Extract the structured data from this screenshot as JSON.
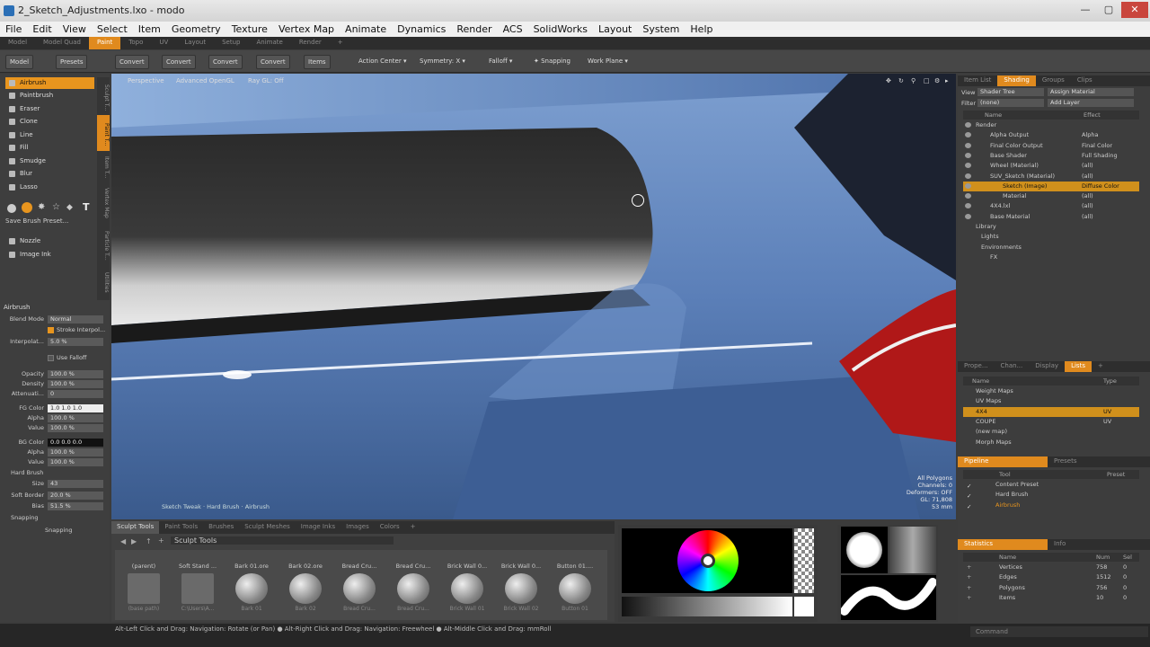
{
  "window": {
    "title": "2_Sketch_Adjustments.lxo - modo"
  },
  "menu": [
    "File",
    "Edit",
    "View",
    "Select",
    "Item",
    "Geometry",
    "Texture",
    "Vertex Map",
    "Animate",
    "Dynamics",
    "Render",
    "ACS",
    "SolidWorks",
    "Layout",
    "System",
    "Help"
  ],
  "layout_tabs": [
    "Model",
    "Model Quad",
    "Paint",
    "Topo",
    "UV",
    "Layout",
    "Setup",
    "Animate",
    "Render",
    "+"
  ],
  "toolbar": {
    "model": "Model",
    "presets": "Presets",
    "convert1": "Convert",
    "convert2": "Convert",
    "convert3": "Convert",
    "convert4": "Convert",
    "items": "Items",
    "action_center": "Action Center",
    "symmetry": "Symmetry: X",
    "falloff": "Falloff",
    "snapping": "Snapping",
    "work_plane": "Work Plane"
  },
  "paint_tools": [
    "Airbrush",
    "Paintbrush",
    "Eraser",
    "Clone",
    "Line",
    "Fill",
    "Smudge",
    "Blur",
    "Lasso"
  ],
  "save_brush_preset": "Save Brush Preset...",
  "nozzle": "Nozzle",
  "image_ink": "Image Ink",
  "vtabs": [
    "Sculpt T...",
    "Paint T...",
    "Item T...",
    "Vertex Map",
    "Particle T...",
    "Utilities"
  ],
  "props": {
    "section": "Airbrush",
    "blend_mode_label": "Blend Mode",
    "blend_mode": "Normal",
    "stroke_interp": "Stroke Interpol...",
    "interpolation_label": "Interpolat...",
    "interpolation": "5.0 %",
    "use_falloff": "Use Falloff",
    "opacity_label": "Opacity",
    "opacity": "100.0 %",
    "density_label": "Density",
    "density": "100.0 %",
    "attenuation_label": "Attenuati...",
    "attenuation": "0",
    "fg_color_label": "FG Color",
    "fg_color": "1.0  1.0  1.0",
    "fg_alpha_label": "Alpha",
    "fg_alpha": "100.0 %",
    "fg_value_label": "Value",
    "fg_value": "100.0 %",
    "bg_color_label": "BG Color",
    "bg_color": "0.0  0.0  0.0",
    "bg_alpha_label": "Alpha",
    "bg_alpha": "100.0 %",
    "bg_value_label": "Value",
    "bg_value": "100.0 %",
    "hard_brush": "Hard Brush",
    "size_label": "Size",
    "size": "43",
    "soft_border_label": "Soft Border",
    "soft_border": "20.0 %",
    "bias_label": "Bias",
    "bias": "51.5 %",
    "snapping_section": "Snapping",
    "snapping_label": "Snapping"
  },
  "viewport": {
    "view": "Perspective",
    "shading": "Advanced OpenGL",
    "raygl": "Ray GL: Off",
    "bottom_info": "Sketch Tweak · Hard Brush · Airbrush",
    "stats": [
      "All Polygons",
      "Channels: 0",
      "Deformers: OFF",
      "GL: 71,808",
      "53 mm"
    ]
  },
  "bottom_tabs": [
    "Sculpt Tools",
    "Paint Tools",
    "Brushes",
    "Sculpt Meshes",
    "Image Inks",
    "Images",
    "Colors",
    "+"
  ],
  "preset_path": "Sculpt Tools",
  "presets": [
    {
      "name": "(parent)",
      "sub": "(base path)"
    },
    {
      "name": "Soft Stand ...",
      "sub": "C:\\Users\\A..."
    },
    {
      "name": "Bark 01.ore",
      "sub": "Bark 01"
    },
    {
      "name": "Bark 02.ore",
      "sub": "Bark 02"
    },
    {
      "name": "Bread Cru...",
      "sub": "Bread Cru..."
    },
    {
      "name": "Bread Cru...",
      "sub": "Bread Cru..."
    },
    {
      "name": "Brick Wall 0...",
      "sub": "Brick Wall 01"
    },
    {
      "name": "Brick Wall 0...",
      "sub": "Brick Wall 02"
    },
    {
      "name": "Button 01....",
      "sub": "Button 01"
    }
  ],
  "status": "Alt-Left Click and Drag: Navigation: Rotate (or Pan) ● Alt-Right Click and Drag: Navigation: Freewheel ● Alt-Middle Click and Drag: mmRoll",
  "command_placeholder": "Command",
  "right": {
    "top_tabs": [
      "Item List",
      "Shading",
      "Groups",
      "Clips"
    ],
    "view_label": "View",
    "view_value": "Shader Tree",
    "assign_material": "Assign Material",
    "filter_label": "Filter",
    "filter_value": "(none)",
    "add_layer": "Add Layer",
    "col_name": "Name",
    "col_effect": "Effect",
    "shader_rows": [
      {
        "name": "Render",
        "effect": "",
        "indent": 14
      },
      {
        "name": "Alpha Output",
        "effect": "Alpha",
        "indent": 30
      },
      {
        "name": "Final Color Output",
        "effect": "Final Color",
        "indent": 30
      },
      {
        "name": "Base Shader",
        "effect": "Full Shading",
        "indent": 30
      },
      {
        "name": "Wheel (Material)",
        "effect": "(all)",
        "indent": 30
      },
      {
        "name": "SUV_Sketch (Material)",
        "effect": "(all)",
        "indent": 30
      },
      {
        "name": "Sketch (Image)",
        "effect": "Diffuse Color",
        "indent": 44,
        "sel": true
      },
      {
        "name": "Material",
        "effect": "(all)",
        "indent": 44
      },
      {
        "name": "4X4.lxl",
        "effect": "(all)",
        "indent": 30
      },
      {
        "name": "Base Material",
        "effect": "(all)",
        "indent": 30
      },
      {
        "name": "Library",
        "effect": "",
        "indent": 14
      },
      {
        "name": "Lights",
        "effect": "",
        "indent": 20
      },
      {
        "name": "Environments",
        "effect": "",
        "indent": 20
      },
      {
        "name": "FX",
        "effect": "",
        "indent": 30
      }
    ],
    "mid_tabs": [
      "Prope...",
      "Chan...",
      "Display",
      "Lists",
      "+"
    ],
    "lists_col_name": "Name",
    "lists_col_type": "Type",
    "list_rows": [
      {
        "name": "Weight Maps",
        "type": ""
      },
      {
        "name": "UV Maps",
        "type": ""
      },
      {
        "name": "4X4",
        "type": "UV",
        "sel": true
      },
      {
        "name": "COUPE",
        "type": "UV"
      },
      {
        "name": "(new map)",
        "type": ""
      },
      {
        "name": "Morph Maps",
        "type": ""
      }
    ],
    "pipeline_tabs": [
      "Pipeline",
      "Presets"
    ],
    "pipe_col_tool": "Tool",
    "pipe_col_preset": "Preset",
    "pipeline_rows": [
      "Content Preset",
      "Hard Brush",
      "Airbrush"
    ],
    "stats_tabs": [
      "Statistics",
      "Info"
    ],
    "stats_col_name": "Name",
    "stats_col_num": "Num",
    "stats_col_sel": "Sel",
    "stats_rows": [
      {
        "name": "Vertices",
        "num": "758",
        "sel": "0"
      },
      {
        "name": "Edges",
        "num": "1512",
        "sel": "0"
      },
      {
        "name": "Polygons",
        "num": "756",
        "sel": "0"
      },
      {
        "name": "Items",
        "num": "10",
        "sel": "0"
      }
    ]
  },
  "colors": {
    "accent": "#e08a1e"
  }
}
